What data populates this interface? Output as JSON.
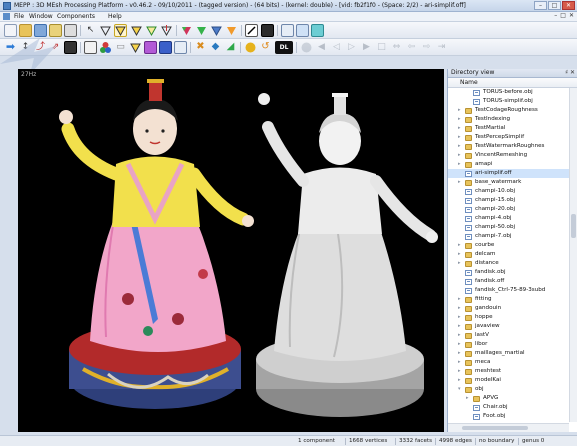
{
  "window": {
    "title": "MEPP : 3D MEsh Processing Platform - v0.46.2 - 09/10/2011 - (tagged version) - (64 bits) - (kernel: double) - [vid: fb2f1f0 - (Space: 2/2) - ari-simplif.off]",
    "buttons": [
      "–",
      "□",
      "✕"
    ]
  },
  "menubar": {
    "items": [
      "File",
      "Window",
      "Components",
      "Help"
    ],
    "mdi_controls": [
      "–",
      "□",
      "✕"
    ]
  },
  "toolbar": {
    "dl_label": "DL"
  },
  "viewport": {
    "fps": "27Hz"
  },
  "dock": {
    "title": "Directory view",
    "controls": "♯ ✕",
    "column_header": "Name",
    "rows": [
      {
        "label": "TORUS-before.obj",
        "type": "file",
        "depth": 2,
        "arrow": ""
      },
      {
        "label": "TORUS-simplif.obj",
        "type": "file",
        "depth": 2,
        "arrow": ""
      },
      {
        "label": "TestCodageRoughness",
        "type": "folder",
        "depth": 1,
        "arrow": "▸"
      },
      {
        "label": "TestIndexing",
        "type": "folder",
        "depth": 1,
        "arrow": "▸"
      },
      {
        "label": "TestMartial",
        "type": "folder",
        "depth": 1,
        "arrow": "▸"
      },
      {
        "label": "TestPercepSimplif",
        "type": "folder",
        "depth": 1,
        "arrow": "▸"
      },
      {
        "label": "TestWatermarkRoughnes",
        "type": "folder",
        "depth": 1,
        "arrow": "▸"
      },
      {
        "label": "VincentRemeshing",
        "type": "folder",
        "depth": 1,
        "arrow": "▸"
      },
      {
        "label": "amapi",
        "type": "folder",
        "depth": 1,
        "arrow": "▸"
      },
      {
        "label": "ari-simplif.off",
        "type": "file",
        "depth": 1,
        "arrow": "",
        "selected": true
      },
      {
        "label": "base_watermark",
        "type": "folder",
        "depth": 1,
        "arrow": "▸"
      },
      {
        "label": "champi-10.obj",
        "type": "file",
        "depth": 1,
        "arrow": ""
      },
      {
        "label": "champi-15.obj",
        "type": "file",
        "depth": 1,
        "arrow": ""
      },
      {
        "label": "champi-20.obj",
        "type": "file",
        "depth": 1,
        "arrow": ""
      },
      {
        "label": "champi-4.obj",
        "type": "file",
        "depth": 1,
        "arrow": ""
      },
      {
        "label": "champi-50.obj",
        "type": "file",
        "depth": 1,
        "arrow": ""
      },
      {
        "label": "champi-7.obj",
        "type": "file",
        "depth": 1,
        "arrow": ""
      },
      {
        "label": "courbe",
        "type": "folder",
        "depth": 1,
        "arrow": "▸"
      },
      {
        "label": "delcam",
        "type": "folder",
        "depth": 1,
        "arrow": "▸"
      },
      {
        "label": "distance",
        "type": "folder",
        "depth": 1,
        "arrow": "▸"
      },
      {
        "label": "fandisk.obj",
        "type": "file",
        "depth": 1,
        "arrow": ""
      },
      {
        "label": "fandisk.off",
        "type": "file",
        "depth": 1,
        "arrow": ""
      },
      {
        "label": "fandisk_Ctrl-75-89-3subd",
        "type": "file",
        "depth": 1,
        "arrow": ""
      },
      {
        "label": "fitting",
        "type": "folder",
        "depth": 1,
        "arrow": "▸"
      },
      {
        "label": "gandouin",
        "type": "folder",
        "depth": 1,
        "arrow": "▸"
      },
      {
        "label": "hoppe",
        "type": "folder",
        "depth": 1,
        "arrow": "▸"
      },
      {
        "label": "javaview",
        "type": "folder",
        "depth": 1,
        "arrow": "▸"
      },
      {
        "label": "lastV",
        "type": "folder",
        "depth": 1,
        "arrow": "▸"
      },
      {
        "label": "libor",
        "type": "folder",
        "depth": 1,
        "arrow": "▸"
      },
      {
        "label": "maillages_martial",
        "type": "folder",
        "depth": 1,
        "arrow": "▸"
      },
      {
        "label": "meca",
        "type": "folder",
        "depth": 1,
        "arrow": "▸"
      },
      {
        "label": "meshtest",
        "type": "folder",
        "depth": 1,
        "arrow": "▸"
      },
      {
        "label": "modelKai",
        "type": "folder",
        "depth": 1,
        "arrow": "▸"
      },
      {
        "label": "obj",
        "type": "folder",
        "depth": 1,
        "arrow": "▾"
      },
      {
        "label": "APVG",
        "type": "folder",
        "depth": 2,
        "arrow": "▸"
      },
      {
        "label": "Chair.obj",
        "type": "file",
        "depth": 2,
        "arrow": ""
      },
      {
        "label": "Foot.obj",
        "type": "file",
        "depth": 2,
        "arrow": ""
      }
    ]
  },
  "statusbar": {
    "components": "1 component",
    "vertices": "1668 vertices",
    "facets": "3332 facets",
    "edges": "4998 edges",
    "boundary": "no boundary",
    "genus": "genus 0"
  },
  "colors": {
    "selection": "#cfe3fb",
    "viewport_bg": "#000000",
    "folder": "#e8c35a"
  }
}
